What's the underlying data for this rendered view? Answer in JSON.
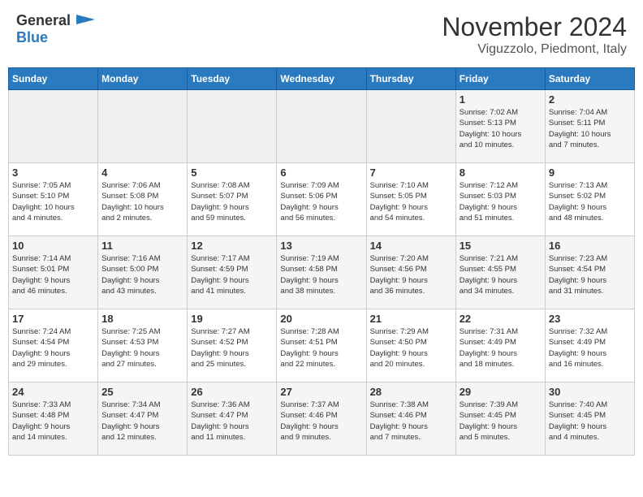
{
  "logo": {
    "general": "General",
    "blue": "Blue"
  },
  "title": "November 2024",
  "location": "Viguzzolo, Piedmont, Italy",
  "weekdays": [
    "Sunday",
    "Monday",
    "Tuesday",
    "Wednesday",
    "Thursday",
    "Friday",
    "Saturday"
  ],
  "weeks": [
    [
      {
        "day": "",
        "info": ""
      },
      {
        "day": "",
        "info": ""
      },
      {
        "day": "",
        "info": ""
      },
      {
        "day": "",
        "info": ""
      },
      {
        "day": "",
        "info": ""
      },
      {
        "day": "1",
        "info": "Sunrise: 7:02 AM\nSunset: 5:13 PM\nDaylight: 10 hours\nand 10 minutes."
      },
      {
        "day": "2",
        "info": "Sunrise: 7:04 AM\nSunset: 5:11 PM\nDaylight: 10 hours\nand 7 minutes."
      }
    ],
    [
      {
        "day": "3",
        "info": "Sunrise: 7:05 AM\nSunset: 5:10 PM\nDaylight: 10 hours\nand 4 minutes."
      },
      {
        "day": "4",
        "info": "Sunrise: 7:06 AM\nSunset: 5:08 PM\nDaylight: 10 hours\nand 2 minutes."
      },
      {
        "day": "5",
        "info": "Sunrise: 7:08 AM\nSunset: 5:07 PM\nDaylight: 9 hours\nand 59 minutes."
      },
      {
        "day": "6",
        "info": "Sunrise: 7:09 AM\nSunset: 5:06 PM\nDaylight: 9 hours\nand 56 minutes."
      },
      {
        "day": "7",
        "info": "Sunrise: 7:10 AM\nSunset: 5:05 PM\nDaylight: 9 hours\nand 54 minutes."
      },
      {
        "day": "8",
        "info": "Sunrise: 7:12 AM\nSunset: 5:03 PM\nDaylight: 9 hours\nand 51 minutes."
      },
      {
        "day": "9",
        "info": "Sunrise: 7:13 AM\nSunset: 5:02 PM\nDaylight: 9 hours\nand 48 minutes."
      }
    ],
    [
      {
        "day": "10",
        "info": "Sunrise: 7:14 AM\nSunset: 5:01 PM\nDaylight: 9 hours\nand 46 minutes."
      },
      {
        "day": "11",
        "info": "Sunrise: 7:16 AM\nSunset: 5:00 PM\nDaylight: 9 hours\nand 43 minutes."
      },
      {
        "day": "12",
        "info": "Sunrise: 7:17 AM\nSunset: 4:59 PM\nDaylight: 9 hours\nand 41 minutes."
      },
      {
        "day": "13",
        "info": "Sunrise: 7:19 AM\nSunset: 4:58 PM\nDaylight: 9 hours\nand 38 minutes."
      },
      {
        "day": "14",
        "info": "Sunrise: 7:20 AM\nSunset: 4:56 PM\nDaylight: 9 hours\nand 36 minutes."
      },
      {
        "day": "15",
        "info": "Sunrise: 7:21 AM\nSunset: 4:55 PM\nDaylight: 9 hours\nand 34 minutes."
      },
      {
        "day": "16",
        "info": "Sunrise: 7:23 AM\nSunset: 4:54 PM\nDaylight: 9 hours\nand 31 minutes."
      }
    ],
    [
      {
        "day": "17",
        "info": "Sunrise: 7:24 AM\nSunset: 4:54 PM\nDaylight: 9 hours\nand 29 minutes."
      },
      {
        "day": "18",
        "info": "Sunrise: 7:25 AM\nSunset: 4:53 PM\nDaylight: 9 hours\nand 27 minutes."
      },
      {
        "day": "19",
        "info": "Sunrise: 7:27 AM\nSunset: 4:52 PM\nDaylight: 9 hours\nand 25 minutes."
      },
      {
        "day": "20",
        "info": "Sunrise: 7:28 AM\nSunset: 4:51 PM\nDaylight: 9 hours\nand 22 minutes."
      },
      {
        "day": "21",
        "info": "Sunrise: 7:29 AM\nSunset: 4:50 PM\nDaylight: 9 hours\nand 20 minutes."
      },
      {
        "day": "22",
        "info": "Sunrise: 7:31 AM\nSunset: 4:49 PM\nDaylight: 9 hours\nand 18 minutes."
      },
      {
        "day": "23",
        "info": "Sunrise: 7:32 AM\nSunset: 4:49 PM\nDaylight: 9 hours\nand 16 minutes."
      }
    ],
    [
      {
        "day": "24",
        "info": "Sunrise: 7:33 AM\nSunset: 4:48 PM\nDaylight: 9 hours\nand 14 minutes."
      },
      {
        "day": "25",
        "info": "Sunrise: 7:34 AM\nSunset: 4:47 PM\nDaylight: 9 hours\nand 12 minutes."
      },
      {
        "day": "26",
        "info": "Sunrise: 7:36 AM\nSunset: 4:47 PM\nDaylight: 9 hours\nand 11 minutes."
      },
      {
        "day": "27",
        "info": "Sunrise: 7:37 AM\nSunset: 4:46 PM\nDaylight: 9 hours\nand 9 minutes."
      },
      {
        "day": "28",
        "info": "Sunrise: 7:38 AM\nSunset: 4:46 PM\nDaylight: 9 hours\nand 7 minutes."
      },
      {
        "day": "29",
        "info": "Sunrise: 7:39 AM\nSunset: 4:45 PM\nDaylight: 9 hours\nand 5 minutes."
      },
      {
        "day": "30",
        "info": "Sunrise: 7:40 AM\nSunset: 4:45 PM\nDaylight: 9 hours\nand 4 minutes."
      }
    ]
  ]
}
